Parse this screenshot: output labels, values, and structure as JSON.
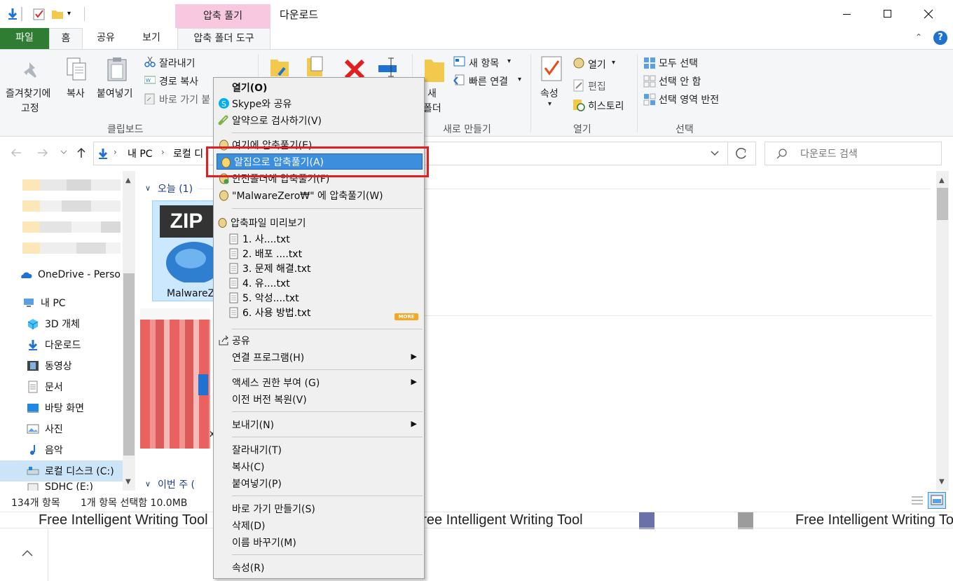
{
  "window": {
    "title": "다운로드",
    "context_tab_group": "압축 풀기"
  },
  "tabs": {
    "file": "파일",
    "home": "홈",
    "share": "공유",
    "view": "보기",
    "zip_tools": "압축 폴더 도구"
  },
  "ribbon": {
    "pin_line1": "즐겨찾기에",
    "pin_line2": "고정",
    "copy": "복사",
    "paste": "붙여넣기",
    "cut": "잘라내기",
    "copy_path": "경로 복사",
    "paste_shortcut": "바로 가기 붙",
    "group_clipboard": "클립보드",
    "new_folder_line1": "새",
    "new_folder_line2": "폴더",
    "new_item": "새 항목",
    "easy_access": "빠른 연결",
    "group_new": "새로 만들기",
    "properties": "속성",
    "open": "열기",
    "edit": "편집",
    "history": "히스토리",
    "group_open": "열기",
    "select_all": "모두 선택",
    "select_none": "선택 안 함",
    "invert_selection": "선택 영역 반전",
    "group_select": "선택"
  },
  "address": {
    "path_pc": "내 PC",
    "path_drive": "로컬 디",
    "search_placeholder": "다운로드 검색"
  },
  "nav": {
    "onedrive": "OneDrive - Perso",
    "my_pc": "내 PC",
    "objects3d": "3D 개체",
    "downloads": "다운로드",
    "videos": "동영상",
    "documents": "문서",
    "desktop": "바탕 화면",
    "pictures": "사진",
    "music": "음악",
    "local_disk": "로컬 디스크 (C:)",
    "sdhc": "SDHC (E:)"
  },
  "content": {
    "group_today": "오늘 (1)",
    "group_this_week": "이번 주 (",
    "zip_badge": "ZIP",
    "file_name": "MalwareZ",
    "partial_x": "x"
  },
  "status": {
    "item_count": "134개 항목",
    "selection": "1개 항목 선택함 10.0MB"
  },
  "bottom": {
    "ad_text_1": "Free Intelligent Writing Tool",
    "ad_text_2": "Free Intelligent Writing Tool",
    "ad_text_3": "Free Intelligent Writing Tool"
  },
  "context_menu": {
    "open": "열기(O)",
    "skype_share": "Skype와 공유",
    "alyac_scan": "알약으로 검사하기(V)",
    "extract_here": "여기에 압축풀기(E)",
    "extract_alzip": "알집으로 압축풀기(A)",
    "extract_safe": "안전폴더에 압축풀기(F)",
    "extract_named": "\"MalwareZero₩\" 에 압축풀기(W)",
    "preview": "압축파일 미리보기",
    "preview_files": [
      "1. 사....txt",
      "2. 배포 ....txt",
      "3. 문제 해결.txt",
      "4. 유....txt",
      "5. 악성....txt",
      "6. 사용 방법.txt"
    ],
    "more_badge": "MORE",
    "share": "공유",
    "open_with": "연결 프로그램(H)",
    "give_access": "액세스 권한 부여 (G)",
    "restore_versions": "이전 버전 복원(V)",
    "send_to": "보내기(N)",
    "cut": "잘라내기(T)",
    "copy": "복사(C)",
    "paste": "붙여넣기(P)",
    "create_shortcut": "바로 가기 만들기(S)",
    "delete": "삭제(D)",
    "rename": "이름 바꾸기(M)",
    "properties": "속성(R)"
  },
  "colors": {
    "file_tab": "#2e7d32",
    "context_tab": "#f7c8e0",
    "menu_highlight": "#3d8fde",
    "annotation_red": "#e02020"
  }
}
